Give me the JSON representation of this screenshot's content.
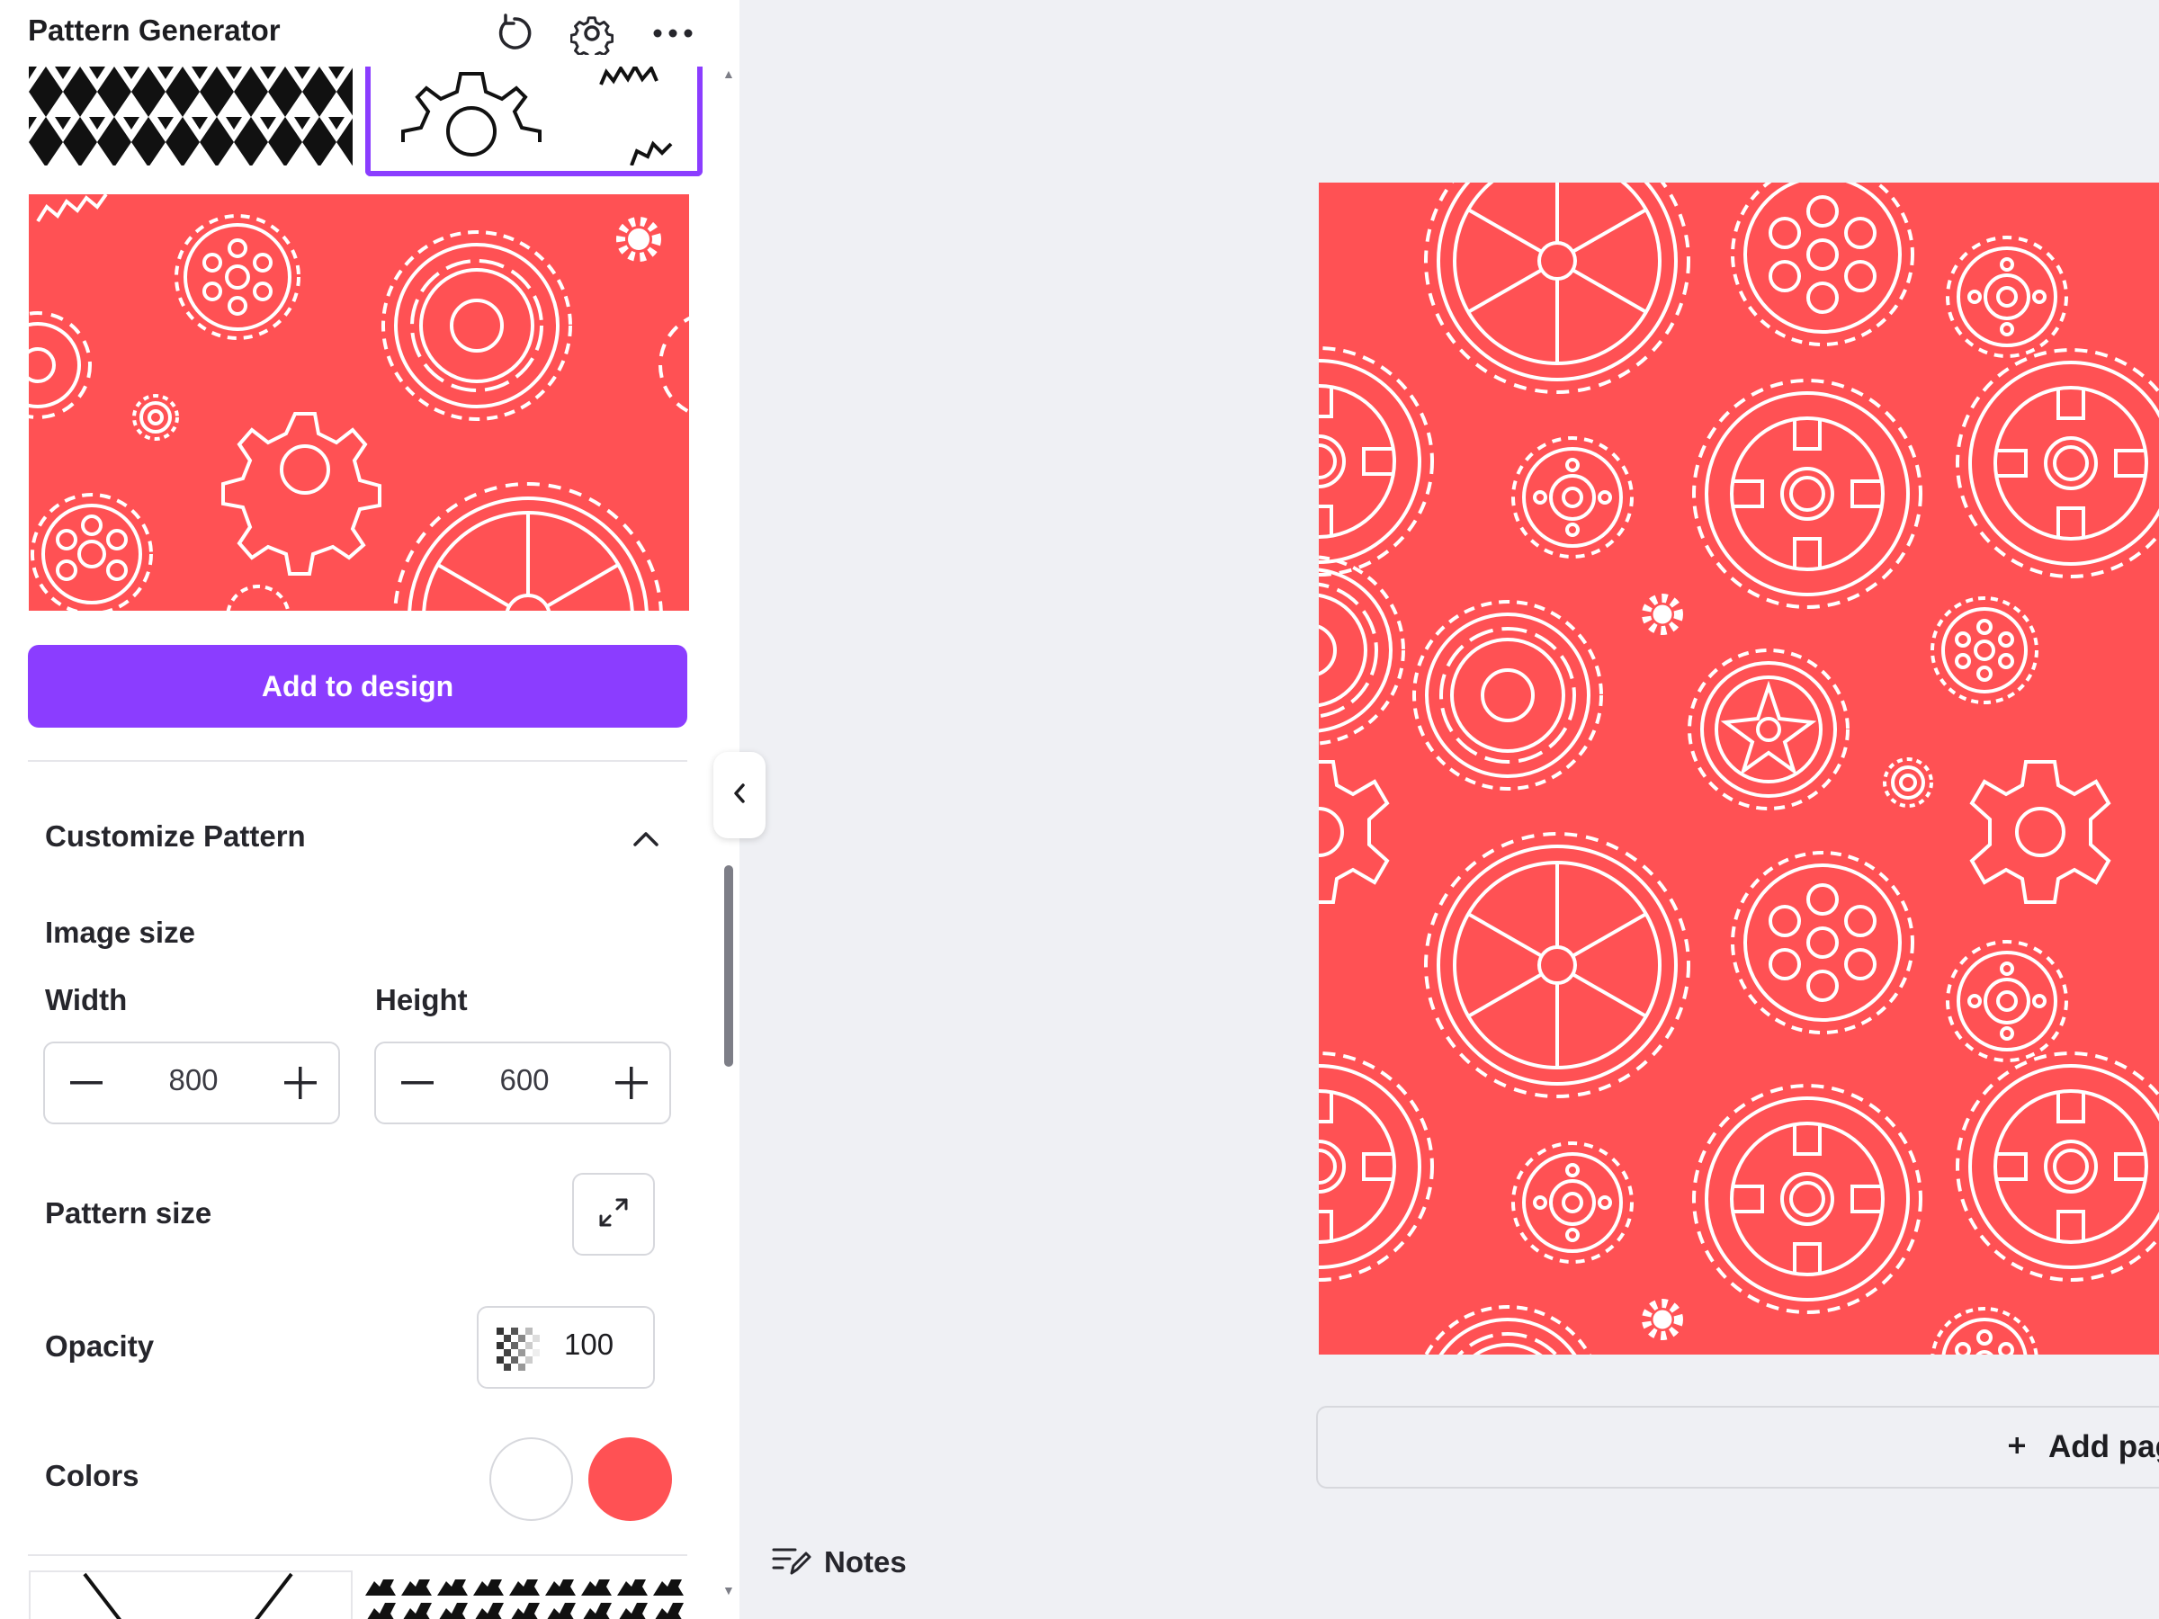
{
  "panel": {
    "title": "Pattern Generator",
    "header_icons": [
      "refresh-icon",
      "gear-icon",
      "more-horizontal-icon"
    ],
    "add_button_label": "Add to design",
    "customize": {
      "title": "Customize Pattern",
      "image_size_label": "Image size",
      "width_label": "Width",
      "width_value": "800",
      "height_label": "Height",
      "height_value": "600",
      "pattern_size_label": "Pattern size",
      "opacity_label": "Opacity",
      "opacity_value": "100",
      "colors_label": "Colors"
    },
    "colors": {
      "foreground": "#ffffff",
      "background": "#ff5154",
      "accent": "#8b3dff"
    }
  },
  "editor": {
    "add_page_label": "Add page",
    "notes_label": "Notes"
  }
}
